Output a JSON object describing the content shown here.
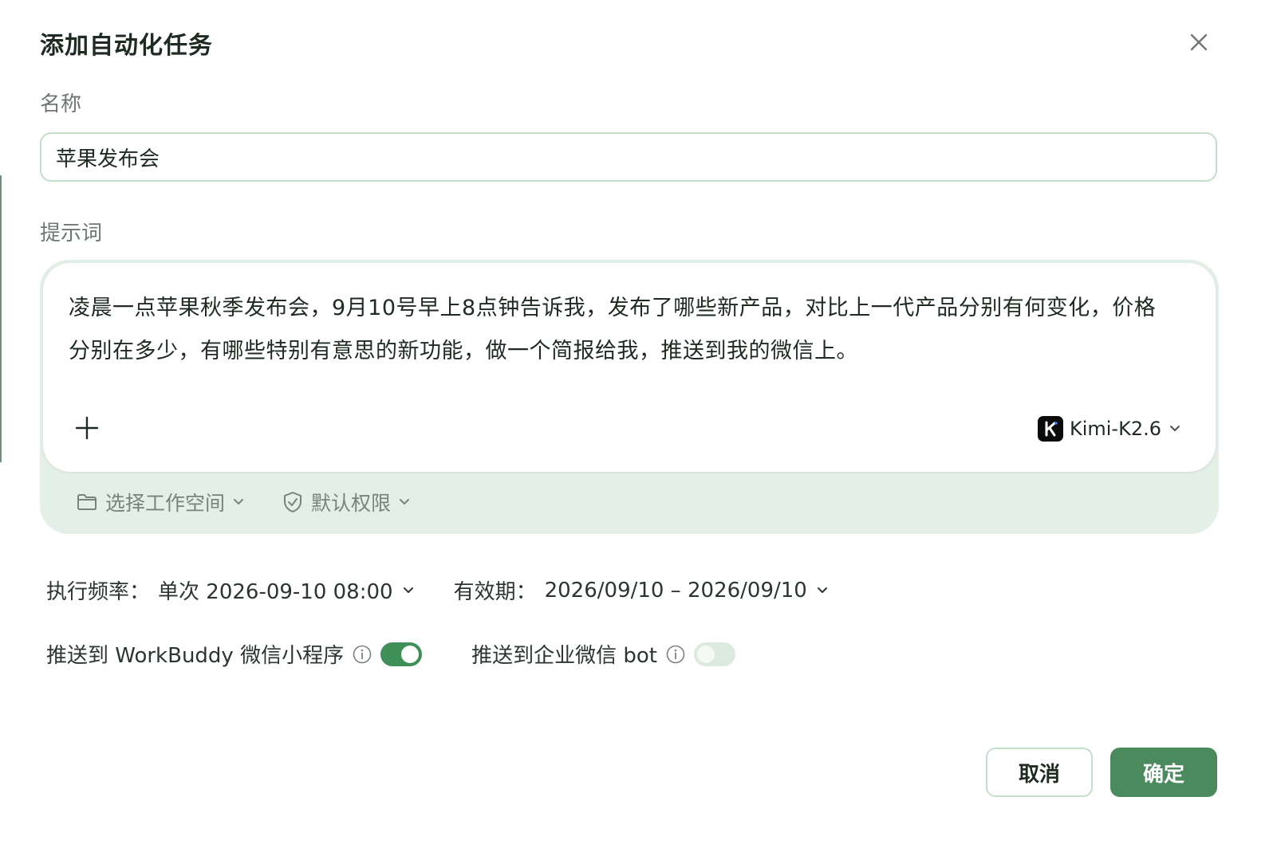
{
  "dialog": {
    "title": "添加自动化任务",
    "close_icon": "close-icon"
  },
  "name_field": {
    "label": "名称",
    "value": "苹果发布会"
  },
  "prompt_field": {
    "label": "提示词",
    "value": "凌晨一点苹果秋季发布会，9月10号早上8点钟告诉我，发布了哪些新产品，对比上一代产品分别有何变化，价格分别在多少，有哪些特别有意思的新功能，做一个简报给我，推送到我的微信上。",
    "add_icon": "plus-icon",
    "model": {
      "label": "Kimi-K2.6",
      "icon": "kimi-logo-icon"
    },
    "workspace": {
      "label": "选择工作空间",
      "icon": "folder-icon"
    },
    "permission": {
      "label": "默认权限",
      "icon": "shield-check-icon"
    }
  },
  "schedule": {
    "frequency_label": "执行频率：",
    "frequency_value": "单次 2026-09-10 08:00",
    "validity_label": "有效期：",
    "validity_value": "2026/09/10 – 2026/09/10"
  },
  "push": {
    "wechat_mini": {
      "label": "推送到 WorkBuddy 微信小程序",
      "enabled": true
    },
    "wecom_bot": {
      "label": "推送到企业微信 bot",
      "enabled": false
    }
  },
  "actions": {
    "cancel": "取消",
    "confirm": "确定"
  },
  "colors": {
    "accent": "#4a8a5d",
    "toggle_on": "#3f8f58",
    "toggle_off": "#dbe9df",
    "prompt_bg": "#e4efe7",
    "border": "#c6ddcc"
  }
}
